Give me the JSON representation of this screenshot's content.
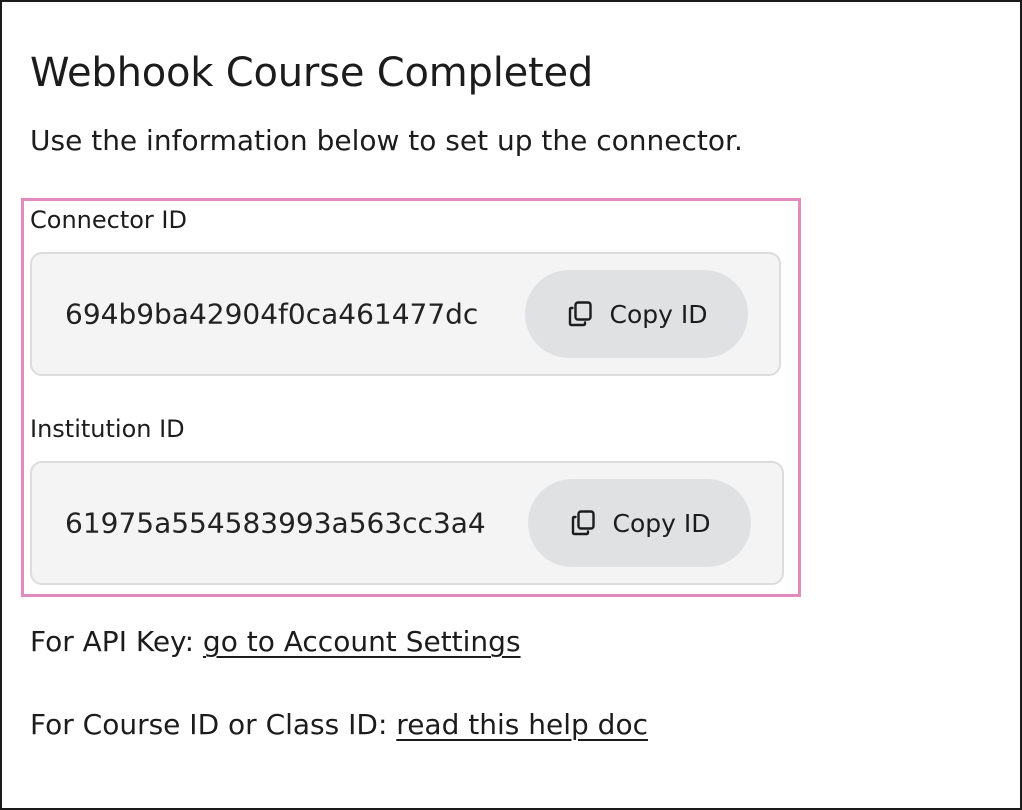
{
  "page": {
    "title": "Webhook Course Completed",
    "subtitle": "Use the information below to set up the connector."
  },
  "connector": {
    "label": "Connector ID",
    "value": "694b9ba42904f0ca461477dc",
    "copy_label": "Copy ID",
    "copy_icon": "copy-icon"
  },
  "institution": {
    "label": "Institution ID",
    "value": "61975a554583993a563cc3a4",
    "copy_label": "Copy ID",
    "copy_icon": "copy-icon"
  },
  "api_key": {
    "prefix": "For API Key:",
    "link_text": "go to Account Settings"
  },
  "course_id": {
    "prefix": "For Course ID or Class ID:",
    "link_text": "read this help doc"
  },
  "colors": {
    "highlight_border": "#e48bbd",
    "id_box_background": "#f4f4f4",
    "button_background": "#dfe1e3",
    "text": "#1c1c1c"
  }
}
